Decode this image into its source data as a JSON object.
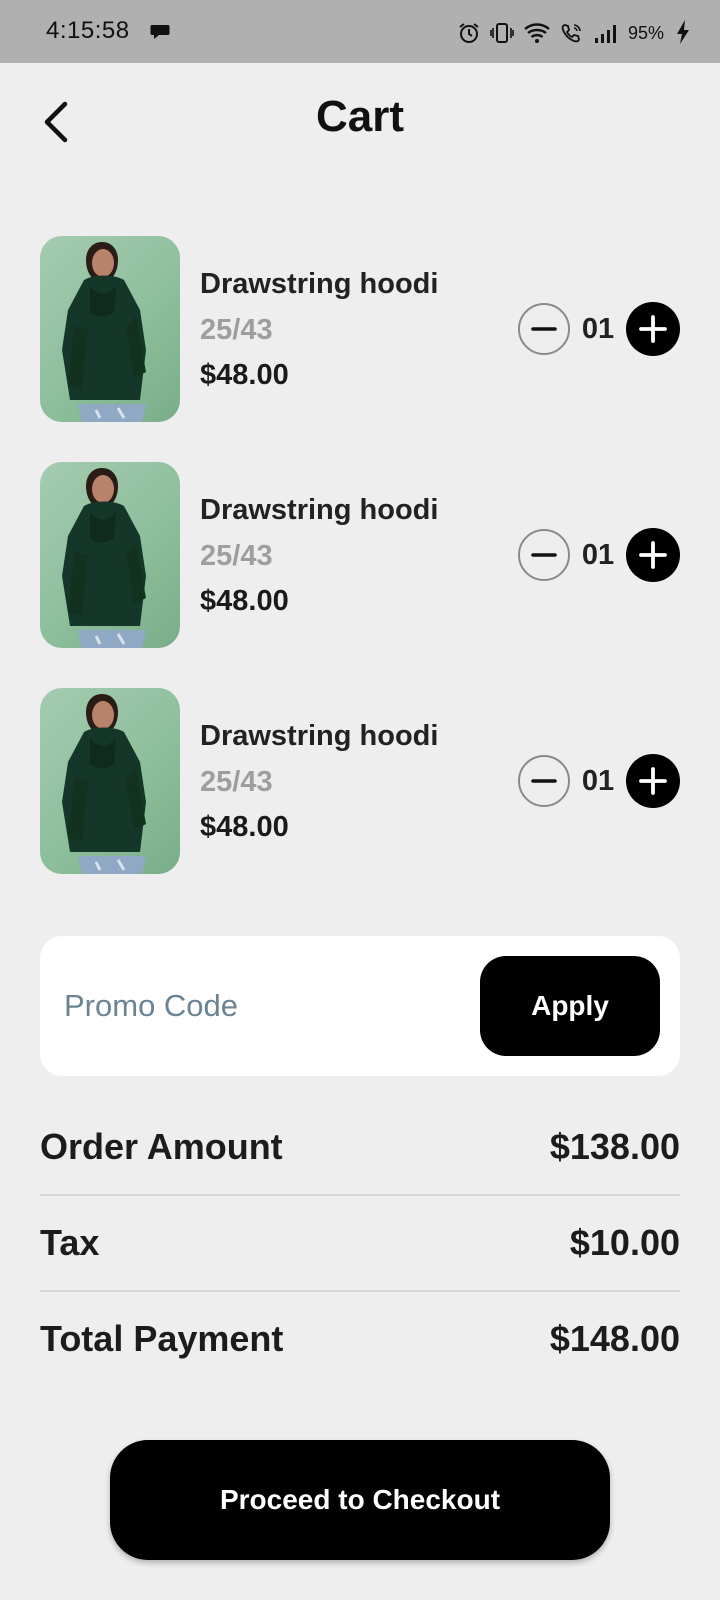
{
  "status_bar": {
    "time": "4:15:58",
    "battery": "95%",
    "icons": [
      "chat-bubble-icon",
      "alarm-icon",
      "vibrate-icon",
      "wifi-icon",
      "wifi-call-icon",
      "signal-icon",
      "charging-bolt-icon"
    ]
  },
  "header": {
    "title": "Cart",
    "back_icon": "chevron-left-icon"
  },
  "cart": {
    "items": [
      {
        "name": "Drawstring hoodi",
        "size": "25/43",
        "price": "$48.00",
        "quantity": "01"
      },
      {
        "name": "Drawstring hoodi",
        "size": "25/43",
        "price": "$48.00",
        "quantity": "01"
      },
      {
        "name": "Drawstring hoodi",
        "size": "25/43",
        "price": "$48.00",
        "quantity": "01"
      }
    ]
  },
  "promo": {
    "placeholder": "Promo Code",
    "value": "",
    "apply_label": "Apply"
  },
  "summary": {
    "order_amount_label": "Order Amount",
    "order_amount_value": "$138.00",
    "tax_label": "Tax",
    "tax_value": "$10.00",
    "total_label": "Total Payment",
    "total_value": "$148.00"
  },
  "checkout": {
    "label": "Proceed to Checkout"
  },
  "colors": {
    "background": "#eeeeee",
    "primary": "#000000",
    "muted_text": "#9e9e9e",
    "placeholder": "#6b8494",
    "thumbnail_bg": "#8ebf9c",
    "status_bar": "#b0b0b0"
  }
}
